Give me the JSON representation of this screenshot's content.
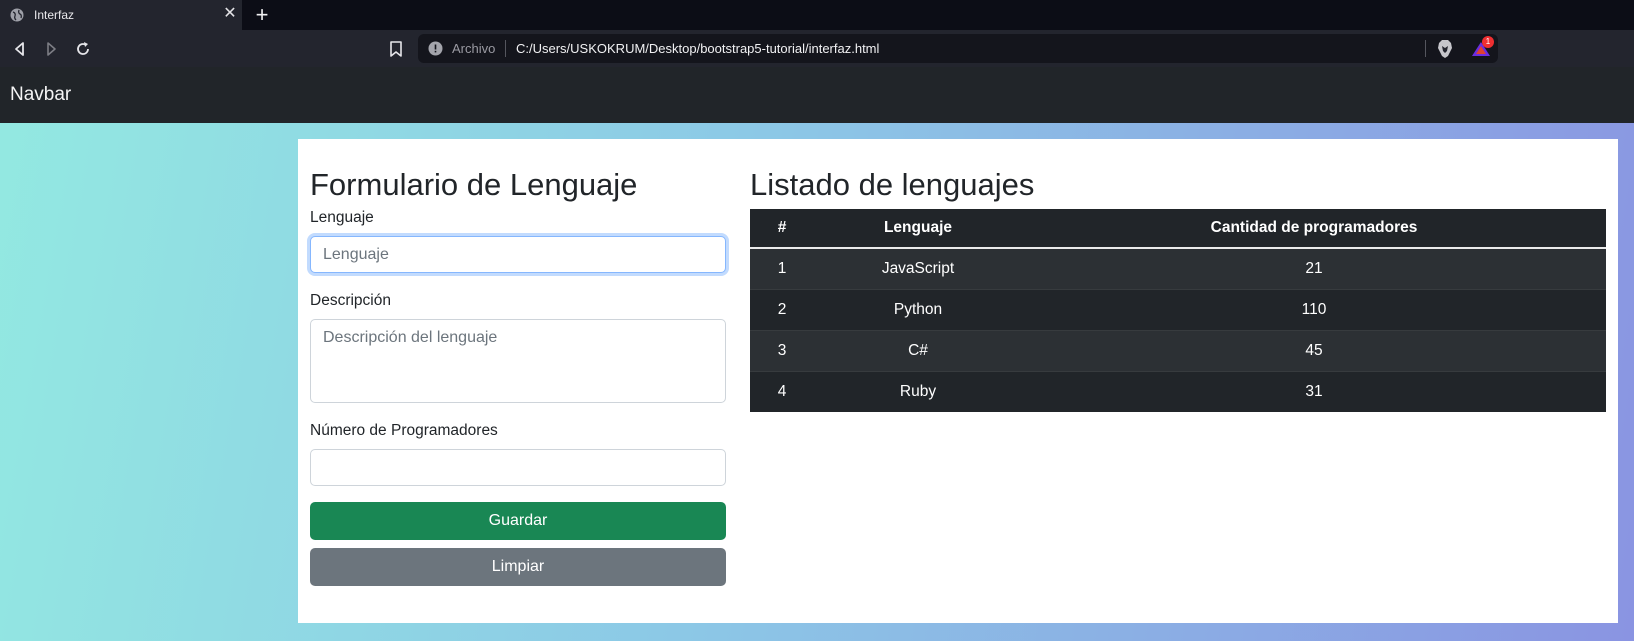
{
  "browser": {
    "tab_title": "Interfaz",
    "protocol_label": "Archivo",
    "url": "C:/Users/USKOKRUM/Desktop/bootstrap5-tutorial/interfaz.html",
    "rewards_badge": "1"
  },
  "navbar": {
    "brand": "Navbar"
  },
  "form": {
    "title": "Formulario de Lenguaje",
    "language_label": "Lenguaje",
    "language_placeholder": "Lenguaje",
    "language_value": "",
    "description_label": "Descripción",
    "description_placeholder": "Descripción del lenguaje",
    "programmers_label": "Número de Programadores",
    "programmers_value": "",
    "save_label": "Guardar",
    "clear_label": "Limpiar"
  },
  "list": {
    "title": "Listado de lenguajes",
    "headers": [
      "#",
      "Lenguaje",
      "Cantidad de programadores"
    ],
    "rows": [
      [
        "1",
        "JavaScript",
        "21"
      ],
      [
        "2",
        "Python",
        "110"
      ],
      [
        "3",
        "C#",
        "45"
      ],
      [
        "4",
        "Ruby",
        "31"
      ]
    ]
  },
  "colors": {
    "navbar_bg": "#212529",
    "save_button": "#198754",
    "clear_button": "#6c757d",
    "table_bg": "#212529"
  },
  "icons": [
    "globe-icon",
    "close-icon",
    "plus-icon",
    "back-icon",
    "forward-icon",
    "reload-icon",
    "bookmark-icon",
    "info-icon",
    "brave-shield-icon",
    "rewards-icon"
  ]
}
